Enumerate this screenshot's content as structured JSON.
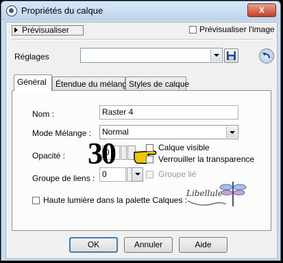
{
  "window": {
    "title": "Propriétés du calque",
    "close_label": "X"
  },
  "preview": {
    "label": "Prévisualiser",
    "image_label": "Prévisualiser l'image"
  },
  "presets": {
    "label": "Réglages",
    "value": ""
  },
  "tabs": [
    {
      "label": "Général"
    },
    {
      "label": "Étendue du mélange"
    },
    {
      "label": "Styles de calque"
    }
  ],
  "general": {
    "name_label": "Nom :",
    "name_value": "Raster 4",
    "blend_label": "Mode Mélange :",
    "blend_value": "Normal",
    "opacity_label": "Opacité :",
    "opacity_value": "0",
    "opacity_overlay": "30",
    "visible_label": "Calque visible",
    "lock_label": "Verrouiller la transparence",
    "group_label": "Groupe de liens :",
    "group_value": "0",
    "linked_label": "Groupe lié",
    "highlight_label": "Haute lumière dans la palette Calques :"
  },
  "watermark": {
    "text": "Libellule"
  },
  "buttons": {
    "ok": "OK",
    "cancel": "Annuler",
    "help": "Aide"
  }
}
